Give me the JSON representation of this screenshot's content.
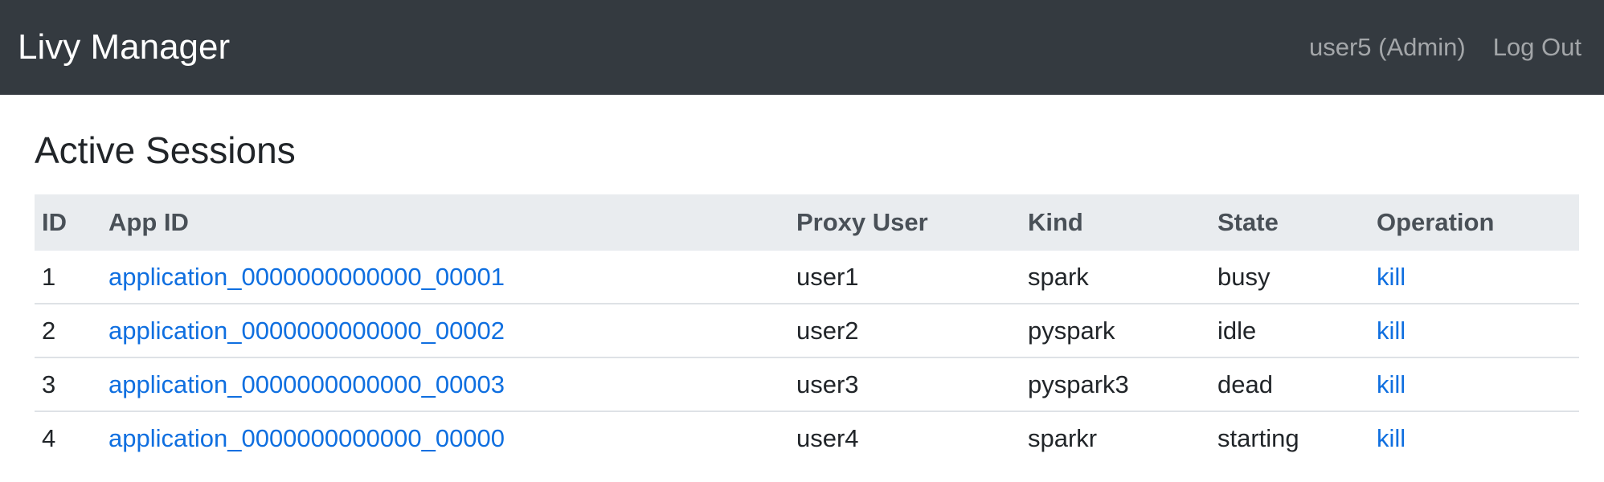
{
  "navbar": {
    "brand": "Livy Manager",
    "user": "user5 (Admin)",
    "logout": "Log Out"
  },
  "page": {
    "title": "Active Sessions"
  },
  "table": {
    "headers": {
      "id": "ID",
      "app_id": "App ID",
      "proxy_user": "Proxy User",
      "kind": "Kind",
      "state": "State",
      "operation": "Operation"
    },
    "rows": [
      {
        "id": "1",
        "app_id": "application_0000000000000_00001",
        "proxy_user": "user1",
        "kind": "spark",
        "state": "busy",
        "operation": "kill"
      },
      {
        "id": "2",
        "app_id": "application_0000000000000_00002",
        "proxy_user": "user2",
        "kind": "pyspark",
        "state": "idle",
        "operation": "kill"
      },
      {
        "id": "3",
        "app_id": "application_0000000000000_00003",
        "proxy_user": "user3",
        "kind": "pyspark3",
        "state": "dead",
        "operation": "kill"
      },
      {
        "id": "4",
        "app_id": "application_0000000000000_00000",
        "proxy_user": "user4",
        "kind": "sparkr",
        "state": "starting",
        "operation": "kill"
      }
    ]
  },
  "colors": {
    "navbar_bg": "#343a40",
    "link": "#0f6fe0",
    "header_row_bg": "#e9ecef"
  }
}
